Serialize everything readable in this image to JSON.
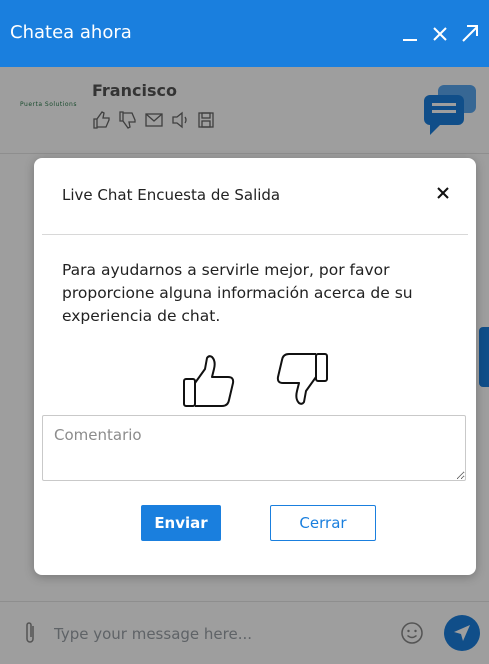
{
  "header": {
    "title": "Chatea ahora",
    "color": "#1a7fde"
  },
  "agent": {
    "name": "Francisco",
    "logo_text": "Puerta Solutions",
    "actions": [
      "thumbs-up-icon",
      "thumbs-down-icon",
      "envelope-icon",
      "speaker-icon",
      "save-icon"
    ]
  },
  "input_bar": {
    "placeholder": "Type your message here..."
  },
  "survey": {
    "title": "Live Chat Encuesta de Salida",
    "message": "Para ayudarnos a servirle mejor, por favor proporcione alguna información acerca de su experiencia de chat.",
    "comment_placeholder": "Comentario",
    "submit_label": "Enviar",
    "close_label": "Cerrar"
  }
}
